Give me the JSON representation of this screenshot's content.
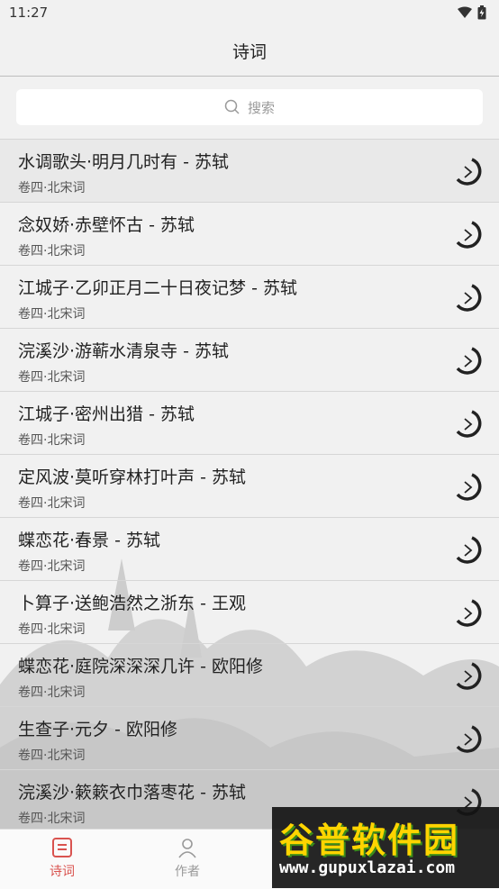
{
  "status_bar": {
    "time": "11:27"
  },
  "header": {
    "title": "诗词"
  },
  "search": {
    "placeholder": "搜索"
  },
  "poems": [
    {
      "title": "水调歌头·明月几时有 - 苏轼",
      "subtitle": "卷四·北宋词"
    },
    {
      "title": "念奴娇·赤壁怀古 - 苏轼",
      "subtitle": "卷四·北宋词"
    },
    {
      "title": "江城子·乙卯正月二十日夜记梦 - 苏轼",
      "subtitle": "卷四·北宋词"
    },
    {
      "title": "浣溪沙·游蕲水清泉寺 - 苏轼",
      "subtitle": "卷四·北宋词"
    },
    {
      "title": "江城子·密州出猎 - 苏轼",
      "subtitle": "卷四·北宋词"
    },
    {
      "title": "定风波·莫听穿林打叶声 - 苏轼",
      "subtitle": "卷四·北宋词"
    },
    {
      "title": "蝶恋花·春景 - 苏轼",
      "subtitle": "卷四·北宋词"
    },
    {
      "title": "卜算子·送鲍浩然之浙东 - 王观",
      "subtitle": "卷四·北宋词"
    },
    {
      "title": "蝶恋花·庭院深深深几许 - 欧阳修",
      "subtitle": "卷四·北宋词"
    },
    {
      "title": "生查子·元夕 - 欧阳修",
      "subtitle": "卷四·北宋词"
    },
    {
      "title": "浣溪沙·簌簌衣巾落枣花 - 苏轼",
      "subtitle": "卷四·北宋词"
    }
  ],
  "tabs": {
    "poems": {
      "label": "诗词",
      "active": true
    },
    "authors": {
      "label": "作者",
      "active": false
    }
  },
  "watermark": {
    "title": "谷普软件园",
    "url": "www.gupuxlazai.com"
  },
  "colors": {
    "accent": "#d9534f",
    "watermark_yellow": "#ffd400"
  }
}
